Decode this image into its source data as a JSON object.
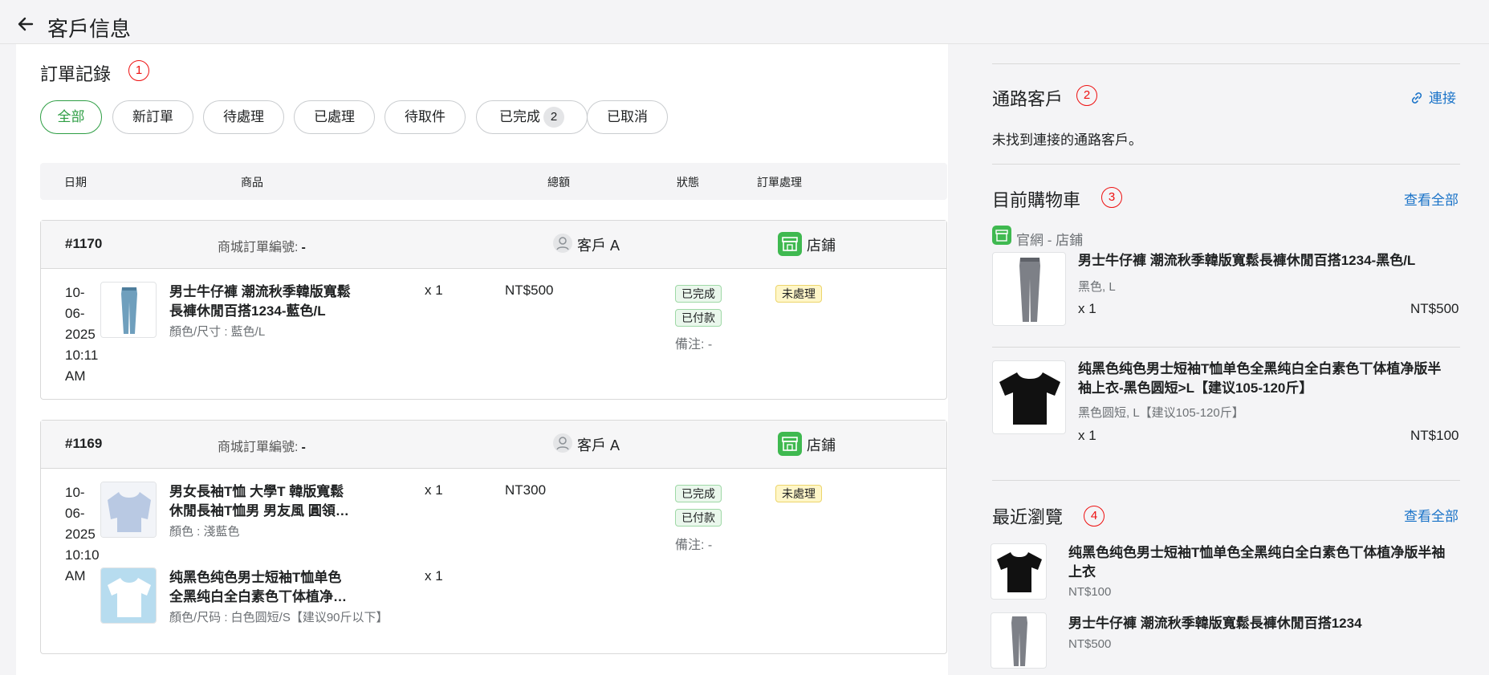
{
  "header": {
    "title": "客戶信息"
  },
  "orders_section": {
    "title": "訂單記錄",
    "badge": "1",
    "tabs": [
      {
        "label": "全部",
        "active": true
      },
      {
        "label": "新訂單"
      },
      {
        "label": "待處理"
      },
      {
        "label": "已處理"
      },
      {
        "label": "待取件"
      },
      {
        "label": "已完成",
        "count": "2"
      },
      {
        "label": "已取消"
      }
    ],
    "columns": [
      "日期",
      "商品",
      "總額",
      "狀態",
      "訂單處理"
    ],
    "mall_order_label": "商城訂單編號:",
    "orders": [
      {
        "id": "#1170",
        "mall_order_no": "-",
        "customer": "客戶 A",
        "channel": "店鋪",
        "date_lines": [
          "10-",
          "06-",
          "2025",
          "10:11",
          "AM"
        ],
        "items": [
          {
            "title_line1": "男士牛仔褲 潮流秋季韓版寬鬆",
            "title_line2": "長褲休閒百搭1234-藍色/L",
            "variant": "顏色/尺寸 : 藍色/L",
            "qty": "x 1",
            "image": "jeans-blue"
          }
        ],
        "amount": "NT$500",
        "statuses": [
          "已完成",
          "已付款"
        ],
        "note": "備注: -",
        "processing": "未處理"
      },
      {
        "id": "#1169",
        "mall_order_no": "-",
        "customer": "客戶 A",
        "channel": "店鋪",
        "date_lines": [
          "10-",
          "06-",
          "2025",
          "10:10",
          "AM"
        ],
        "items": [
          {
            "title_line1": "男女長袖T恤 大學T 韓版寬鬆",
            "title_line2": "休閒長袖T恤男 男友風 圓領…",
            "variant": "顏色 : 淺藍色",
            "qty": "x 1",
            "image": "sweatshirt-lightblue"
          },
          {
            "title_line1": "纯黑色纯色男士短袖T恤单色",
            "title_line2": "全黑纯白全白素色丅体植净…",
            "variant": "顏色/尺码 : 白色圆短/S【建议90斤以下】",
            "qty": "x 1",
            "image": "tshirt-white"
          }
        ],
        "amount": "NT300",
        "statuses": [
          "已完成",
          "已付款"
        ],
        "note": "備注: -",
        "processing": "未處理"
      }
    ]
  },
  "channel_customer": {
    "title": "通路客戶",
    "badge": "2",
    "link_label": "連接",
    "empty_text": "未找到連接的通路客戶。"
  },
  "cart": {
    "title": "目前購物車",
    "badge": "3",
    "view_all": "查看全部",
    "source": "官網 - 店鋪",
    "items": [
      {
        "title": "男士牛仔褲 潮流秋季韓版寬鬆長褲休閒百搭1234-黑色/L",
        "variant": "黑色, L",
        "qty": "x 1",
        "price": "NT$500",
        "image": "jeans-gray"
      },
      {
        "title_line1": "纯黑色纯色男士短袖T恤单色全黑纯白全白素色丅体植净版半",
        "title_line2": "袖上衣-黑色圆短>L【建议105-120斤】",
        "variant": "黑色圆短, L【建议105-120斤】",
        "qty": "x 1",
        "price": "NT$100",
        "image": "tshirt-black"
      }
    ]
  },
  "recent": {
    "title": "最近瀏覽",
    "badge": "4",
    "view_all": "查看全部",
    "items": [
      {
        "title_line1": "纯黑色纯色男士短袖T恤单色全黑纯白全白素色丅体植净版半袖",
        "title_line2": "上衣",
        "price": "NT$100",
        "image": "tshirt-black"
      },
      {
        "title": "男士牛仔褲 潮流秋季韓版寬鬆長褲休閒百搭1234",
        "price": "NT$500",
        "image": "jeans-gray"
      }
    ]
  },
  "colors": {
    "accent_green": "#2e9e44",
    "link_blue": "#1a73c8",
    "annotation_red": "#e11111"
  }
}
